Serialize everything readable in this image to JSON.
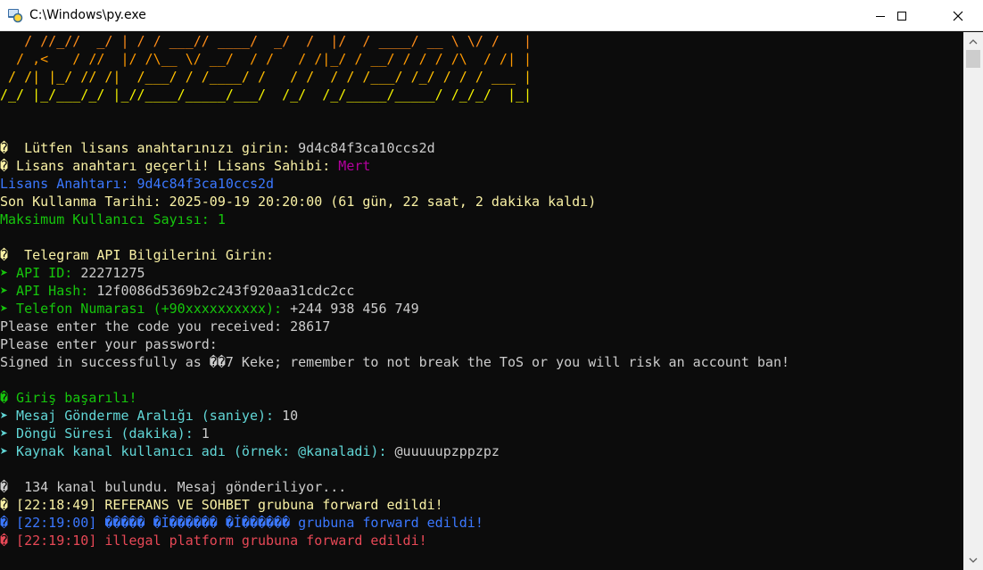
{
  "window": {
    "title": "C:\\Windows\\py.exe",
    "minimize_glyph": "—",
    "maximize_glyph": "☐",
    "close_glyph": "✕"
  },
  "colors": {
    "banner_orange": "#ff8c1a",
    "banner_yellow": "#f1f100",
    "white": "#cccccc",
    "yellow": "#f9f1a5",
    "green": "#16c60c",
    "cyan": "#61d6d6",
    "magenta": "#b4009e",
    "blue": "#3b78ff",
    "red": "#e74856"
  },
  "banner": [
    {
      "text": "   / //_//  _/ | / / ___// ____/  _/  /  |/  / ____/ __ \\ \\/ /   |",
      "color": "#ff8c1a"
    },
    {
      "text": "  / ,<   / //  |/ /\\__ \\/ __/  / /   / /|_/ / __/ / / / /\\  / /| |",
      "color": "#ff9900"
    },
    {
      "text": " / /| |_/ // /|  /___/ / /____/ /   / /  / / /___/ /_/ / / / ___ |",
      "color": "#ffbf00"
    },
    {
      "text": "/_/ |_/___/_/ |_//____/_____/___/  /_/  /_/_____/_____/ /_/_/  |_|",
      "color": "#f1f100"
    }
  ],
  "lines": [
    {
      "segments": [
        {
          "text": "�  Lütfen lisans anahtarınızı girin: ",
          "color": "#f9f1a5"
        },
        {
          "text": "9d4c84f3ca10ccs2d",
          "color": "#cccccc"
        }
      ]
    },
    {
      "segments": [
        {
          "text": "� Lisans anahtarı geçerli! Lisans Sahibi: ",
          "color": "#f9f1a5"
        },
        {
          "text": "Mert",
          "color": "#b4009e"
        }
      ]
    },
    {
      "segments": [
        {
          "text": "Lisans Anahtarı: 9d4c84f3ca10ccs2d",
          "color": "#3b78ff"
        }
      ]
    },
    {
      "segments": [
        {
          "text": "Son Kullanma Tarihi: 2025-09-19 20:20:00 (61 gün, 22 saat, 2 dakika kaldı)",
          "color": "#f9f1a5"
        }
      ]
    },
    {
      "segments": [
        {
          "text": "Maksimum Kullanıcı Sayısı: 1",
          "color": "#16c60c"
        }
      ]
    },
    {
      "segments": []
    },
    {
      "segments": [
        {
          "text": "�  Telegram API Bilgilerini Girin:",
          "color": "#f9f1a5"
        }
      ]
    },
    {
      "segments": [
        {
          "text": "➤ API ID: ",
          "color": "#16c60c"
        },
        {
          "text": "22271275",
          "color": "#cccccc"
        }
      ]
    },
    {
      "segments": [
        {
          "text": "➤ API Hash: ",
          "color": "#16c60c"
        },
        {
          "text": "12f0086d5369b2c243f920aa31cdc2cc",
          "color": "#cccccc"
        }
      ]
    },
    {
      "segments": [
        {
          "text": "➤ Telefon Numarası (+90xxxxxxxxxx): ",
          "color": "#16c60c"
        },
        {
          "text": "+244 938 456 749",
          "color": "#cccccc"
        }
      ]
    },
    {
      "segments": [
        {
          "text": "Please enter the code you received: 28617",
          "color": "#cccccc"
        }
      ]
    },
    {
      "segments": [
        {
          "text": "Please enter your password:",
          "color": "#cccccc"
        }
      ]
    },
    {
      "segments": [
        {
          "text": "Signed in successfully as ��7 Keke; remember to not break the ToS or you will risk an account ban!",
          "color": "#cccccc"
        }
      ]
    },
    {
      "segments": []
    },
    {
      "segments": [
        {
          "text": "� Giriş başarılı!",
          "color": "#16c60c"
        }
      ]
    },
    {
      "segments": [
        {
          "text": "➤ Mesaj Gönderme Aralığı (saniye): ",
          "color": "#61d6d6"
        },
        {
          "text": "10",
          "color": "#cccccc"
        }
      ]
    },
    {
      "segments": [
        {
          "text": "➤ Döngü Süresi (dakika): ",
          "color": "#61d6d6"
        },
        {
          "text": "1",
          "color": "#cccccc"
        }
      ]
    },
    {
      "segments": [
        {
          "text": "➤ Kaynak kanal kullanıcı adı (örnek: @kanaladi): ",
          "color": "#61d6d6"
        },
        {
          "text": "@uuuuupzppzpz",
          "color": "#cccccc"
        }
      ]
    },
    {
      "segments": []
    },
    {
      "segments": [
        {
          "text": "�  134 kanal bulundu. Mesaj gönderiliyor...",
          "color": "#cccccc"
        }
      ]
    },
    {
      "segments": [
        {
          "text": "� [22:18:49] ",
          "color": "#f9f1a5"
        },
        {
          "text": "REFERANS VE SOHBET grubuna forward edildi!",
          "color": "#f9f1a5"
        }
      ]
    },
    {
      "segments": [
        {
          "text": "� [22:19:00] ",
          "color": "#3b78ff"
        },
        {
          "text": "����� �İ������ �İ������ grubuna forward edildi!",
          "color": "#3b78ff"
        }
      ]
    },
    {
      "segments": [
        {
          "text": "� [22:19:10] ",
          "color": "#e74856"
        },
        {
          "text": "illegal platform grubuna forward edildi!",
          "color": "#e74856"
        }
      ]
    }
  ]
}
